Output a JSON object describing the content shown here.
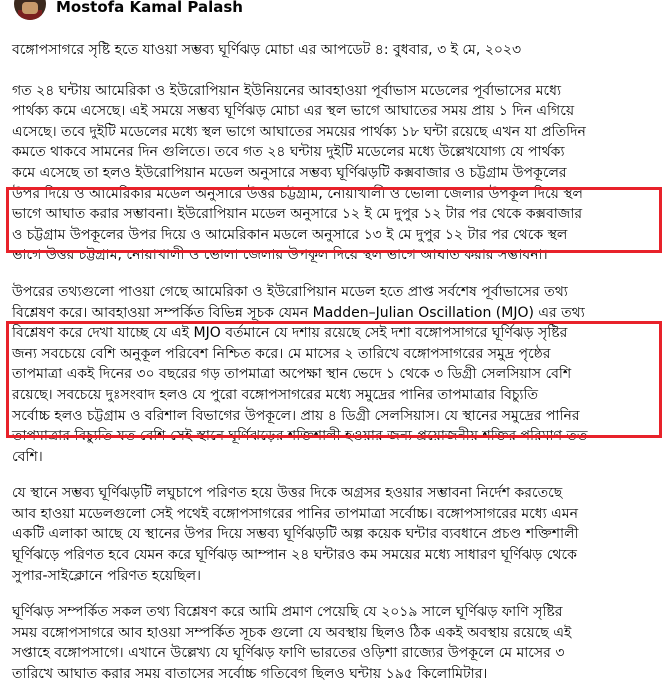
{
  "post": {
    "author": "Mostofa Kamal Palash",
    "title": "বঙ্গোপসাগরে সৃষ্টি হতে যাওয়া সম্ভব্য ঘূর্ণিঝড় মোচা এর আপডেট ৪: বুধবার, ৩ ই মে, ২০২৩",
    "paragraphs": [
      [
        "গত ২৪ ঘন্টায় আমেরিকা ও ইউরোপিয়ান ইউনিয়নের আবহাওয়া পূর্বাভাস মডেলের পূর্বাভাসের মধ্যে",
        "পার্থক্য কমে এসেছে। এই সময়ে সম্ভব্য ঘূর্ণিঝড় মোচা এর স্থল ভাগে আঘাতের সময় প্রায় ১ দিন এগিয়ে",
        "এসেছে। তবে দুইটি মডেলের মধ্যে স্থল ভাগে আঘাতের সময়ের পার্থক্য ১৮ ঘন্টা রয়েছে এখন যা প্রতিদিন",
        "কমতে থাকবে সামনের দিন গুলিতে। তবে গত ২৪ ঘন্টায় দুইটি মডেলের মধ্যে উল্লেখযোগ্য যে পার্থক্য",
        "কমে এসেছে তা হলও ইউরোপিয়ান মডেল অনুসারে সম্ভব্য ঘূর্ণিঝড়টি কক্সবাজার ও চট্টগ্রাম উপকূলের",
        "উপর দিয়ে ও আমেরিকার মডেল অনুসারে উত্তর চট্টগ্রাম, নোয়াখালী ও ভোলা জেলার উপকূল দিয়ে স্থল",
        "ভাগে আঘাত করার সম্ভাবনা। ইউরোপিয়ান মডেল অনুসারে ১২ ই মে দুপুর ১২ টার পর থেকে কক্সবাজার",
        "ও চট্টগ্রাম উপকূলের উপর দিয়ে ও আমেরিকান মডলে অনুসারে ১৩ ই মে দুপুর ১২ টার পর থেকে স্থল",
        "ভাগে উত্তর চট্টগ্রাম, নোয়াখালী ও ভোলা জেলার উপকূল দিয়ে স্থল ভাগে আঘাত করার সম্ভাবনা।"
      ],
      [
        "উপরের তথ্যগুলো পাওয়া গেছে আমেরিকা ও ইউরোপিয়ান মডেল হতে প্রাপ্ত সর্বশেষ পূর্বাভাসের তথ্য",
        "বিশ্লেষণ করে। আবহাওয়া সম্পর্কিত বিভিন্ন সূচক যেমন Madden–Julian Oscillation (MJO) এর তথ্য",
        "বিশ্লেষণ করে দেখা যাচ্ছে যে এই MJO বর্তমানে যে দশায় রয়েছে সেই দশা বঙ্গোপসাগরে ঘূর্ণিঝড় সৃষ্টির",
        "জন্য সবচেয়ে বেশি অনুকূল পরিবেশ নিশ্চিত করে। মে মাসের ২ তারিখে বঙ্গোপসাগরের সমুদ্র পৃষ্ঠের",
        "তাপমাত্রা একই দিনের ৩০ বছরের গড় তাপমাত্রা অপেক্ষা স্থান ভেদে ১ থেকে ৩ ডিগ্রী সেলসিয়াস বেশি",
        "রয়েছে। সবচেয়ে দুঃসংবাদ হলও যে পুরো বঙ্গোপসাগরের মধ্যে সমুদ্রের পানির তাপমাত্রার বিচ্যুতি",
        "সর্বোচ্চ হলও চট্টগ্রাম ও বরিশাল বিভাগের উপকূলে। প্রায় ৪ ডিগ্রী সেলসিয়াস। যে স্থানের সমুদ্রের পানির",
        "তাপমাত্রার বিচ্যুতি যত বেশি সেই স্থানে ঘূর্ণিঝড়ের শক্তিশালী হওয়ার জন্য প্রয়োজনীয় শক্তির পরিমাণ তত",
        "বেশি।"
      ],
      [
        "যে স্থানে সম্ভব্য ঘূর্ণিঝড়টি লঘুচাপে পরিণত হয়ে উত্তর দিকে অগ্রসর হওয়ার সম্ভাবনা নির্দেশ করতেছে",
        "আব হাওয়া মডেলগুলো সেই পথেই বঙ্গোপসাগরের পানির তাপমাত্রা সর্বোচ্চ। বঙ্গোপসাগরের মধ্যে এমন",
        "একটি এলাকা আছে যে স্থানের উপর দিয়ে সম্ভব্য ঘূর্ণিঝড়টি অল্প কয়েক ঘন্টার ব্যবধানে প্রচণ্ড শক্তিশালী",
        "ঘূর্ণিঝড়ে পরিণত হবে যেমন করে ঘূর্ণিঝড় আম্পান ২৪ ঘন্টারও কম সময়ের মধ্যে সাধারণ ঘূর্ণিঝড় থেকে",
        "সুপার-সাইক্লোনে পরিণত হয়েছিল।"
      ],
      [
        "ঘূর্ণিঝড় সম্পর্কিত সকল তথ্য বিশ্লেষণ করে আমি প্রমাণ পেয়েছি যে ২০১৯ সালে ঘূর্ণিঝড় ফাণি সৃষ্টির",
        "সময় বঙ্গোপসাগরে আব হাওয়া সম্পর্কিত সূচক গুলো যে অবস্থায় ছিলও ঠিক একই অবস্থায় রয়েছে এই",
        "সপ্তাহে বঙ্গোপসাগে। এখানে উল্লেখ্য যে ঘূর্ণিঝড় ফাণি ভারতের ওড়িশা রাজ্যের উপকূলে মে মাসের ৩",
        "তারিখে আঘাত করার সময় বাতাসের সর্বোচ্চ গতিবেগ ছিলও ঘন্টায় ১৯৫ কিলোমিটার।"
      ]
    ]
  }
}
